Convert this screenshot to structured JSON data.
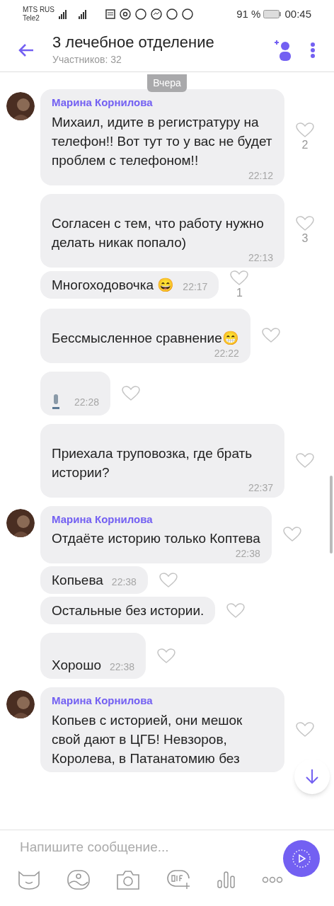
{
  "status_bar": {
    "carriers": [
      "MTS RUS",
      "Tele2"
    ],
    "battery": "91 %",
    "time": "00:45"
  },
  "header": {
    "title": "3 лечебное отделение",
    "subtitle": "Участников: 32"
  },
  "date_chip": "Вчера",
  "messages": [
    {
      "kind": "text",
      "sender": "Марина Корнилова",
      "avatar": true,
      "redacted": false,
      "text": "Михаил, идите в регистратуру на телефон!! Вот тут то у вас не будет проблем с телефоном!!",
      "time": "22:12",
      "likes": "2"
    },
    {
      "kind": "text",
      "avatar": false,
      "redacted": true,
      "text": "Согласен с  тем, что работу нужно делать никак попало)",
      "time": "22:13",
      "likes": "3"
    },
    {
      "kind": "inline",
      "avatar": false,
      "redacted": false,
      "text": "Многоходовочка 😄",
      "time": "22:17",
      "likes": "1"
    },
    {
      "kind": "text",
      "avatar": false,
      "redacted": true,
      "text": "Бессмысленное сравнение😁",
      "time": "22:22"
    },
    {
      "kind": "voice",
      "avatar": false,
      "redacted": true,
      "time": "22:28"
    },
    {
      "kind": "text",
      "avatar": false,
      "redacted": true,
      "text": "Приехала труповозка, где брать истории?",
      "time": "22:37"
    },
    {
      "kind": "text",
      "sender": "Марина Корнилова",
      "avatar": true,
      "redacted": false,
      "text": "Отдаёте историю только Коптева",
      "time": "22:38"
    },
    {
      "kind": "inline",
      "avatar": false,
      "redacted": false,
      "text": "Копьева",
      "time": "22:38"
    },
    {
      "kind": "inline",
      "avatar": false,
      "redacted": false,
      "text": "Остальные без истории."
    },
    {
      "kind": "inline",
      "avatar": false,
      "redacted": true,
      "text": "Хорошо",
      "time": "22:38"
    },
    {
      "kind": "text",
      "sender": "Марина Корнилова",
      "avatar": true,
      "redacted": false,
      "text": "Копьев с историей, они мешок свой дают  в ЦГБ! Невзоров, Королева, в Патанатомию без"
    }
  ],
  "composer": {
    "placeholder": "Напишите сообщение..."
  }
}
